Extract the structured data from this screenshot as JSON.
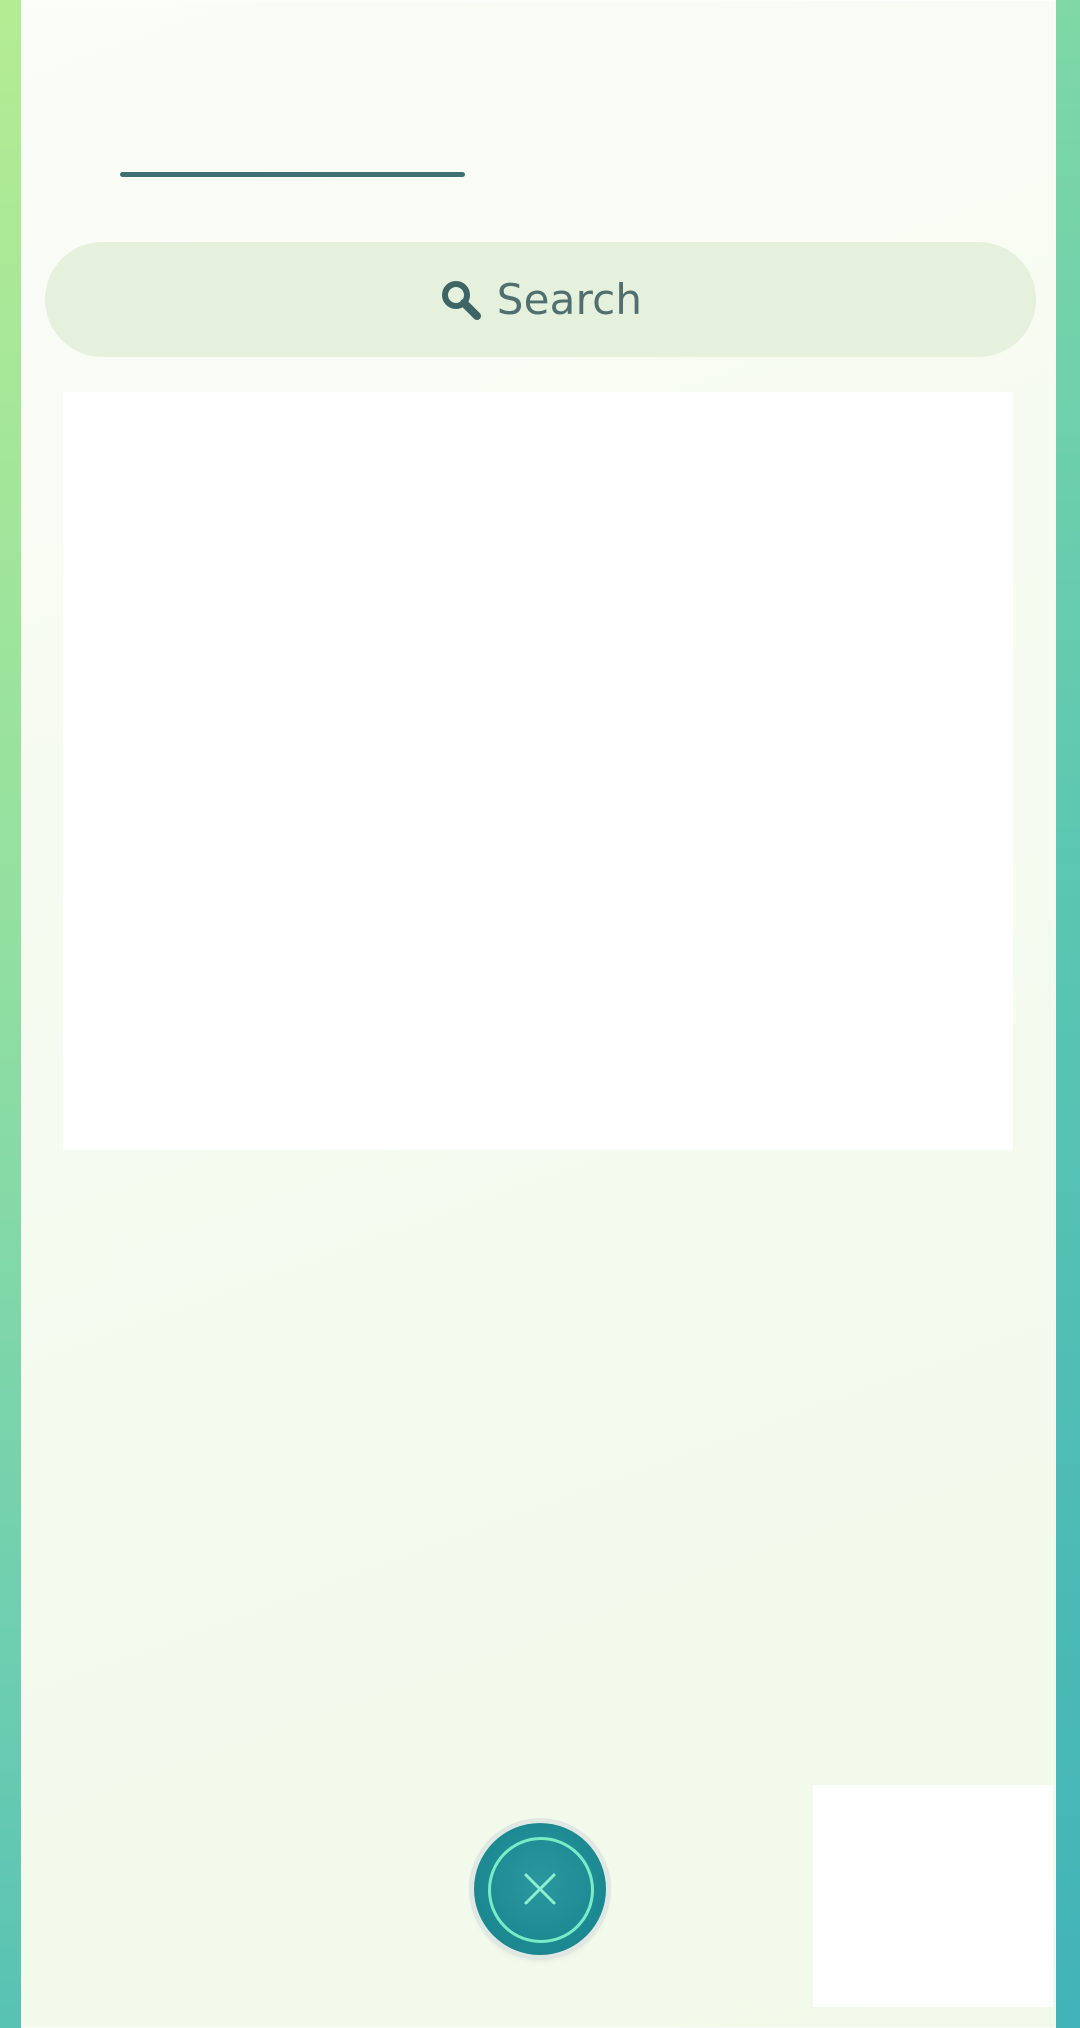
{
  "search": {
    "label": "Search",
    "icon": "search-icon"
  },
  "close_button": {
    "icon": "close-icon"
  },
  "colors": {
    "panel_background": "#f6fbf1",
    "search_background": "#e5f1dc",
    "text_primary": "#4f6f71",
    "accent_teal": "#1d8a93",
    "accent_ring": "#79ecc6",
    "frame_green": "#b4ec93"
  }
}
